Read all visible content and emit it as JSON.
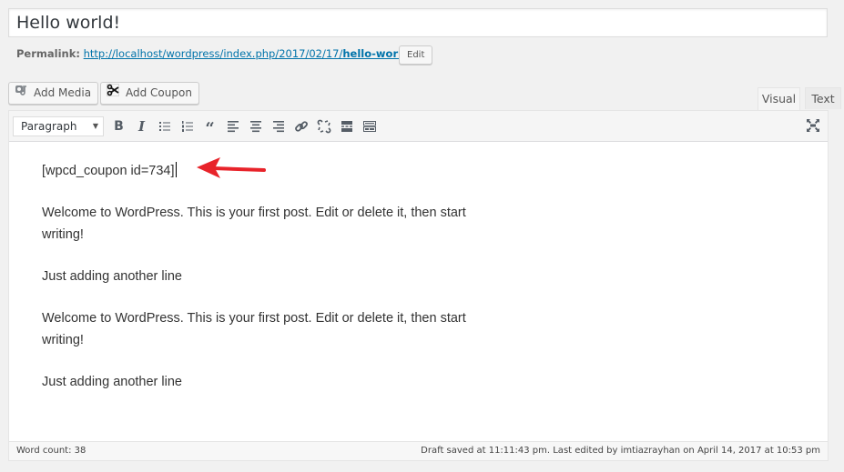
{
  "post": {
    "title": "Hello world!",
    "permalink_label": "Permalink:",
    "permalink_base": "http://localhost/wordpress/index.php/2017/02/17/",
    "permalink_slug": "hello-world/",
    "edit_label": "Edit"
  },
  "media_buttons": {
    "add_media": "Add Media",
    "add_coupon": "Add Coupon"
  },
  "tabs": {
    "visual": "Visual",
    "text": "Text",
    "active": "Visual"
  },
  "toolbar": {
    "format_selected": "Paragraph",
    "buttons": [
      "bold",
      "italic",
      "bulleted-list",
      "numbered-list",
      "blockquote",
      "align-left",
      "align-center",
      "align-right",
      "insert-link",
      "remove-link",
      "read-more",
      "toolbar-toggle"
    ],
    "fullscreen": "distraction-free-mode"
  },
  "content": {
    "paragraphs": [
      "[wpcd_coupon id=734]",
      "Welcome to WordPress. This is your first post. Edit or delete it, then start writing!",
      "Just adding another line",
      "Welcome to WordPress. This is your first post. Edit or delete it, then start writing!",
      "Just adding another line"
    ]
  },
  "annotation": {
    "arrow_color": "#e8232a"
  },
  "status": {
    "word_count": "Word count: 38",
    "draft_info": "Draft saved at 11:11:43 pm. Last edited by imtiazrayhan on April 14, 2017 at 10:53 pm"
  }
}
